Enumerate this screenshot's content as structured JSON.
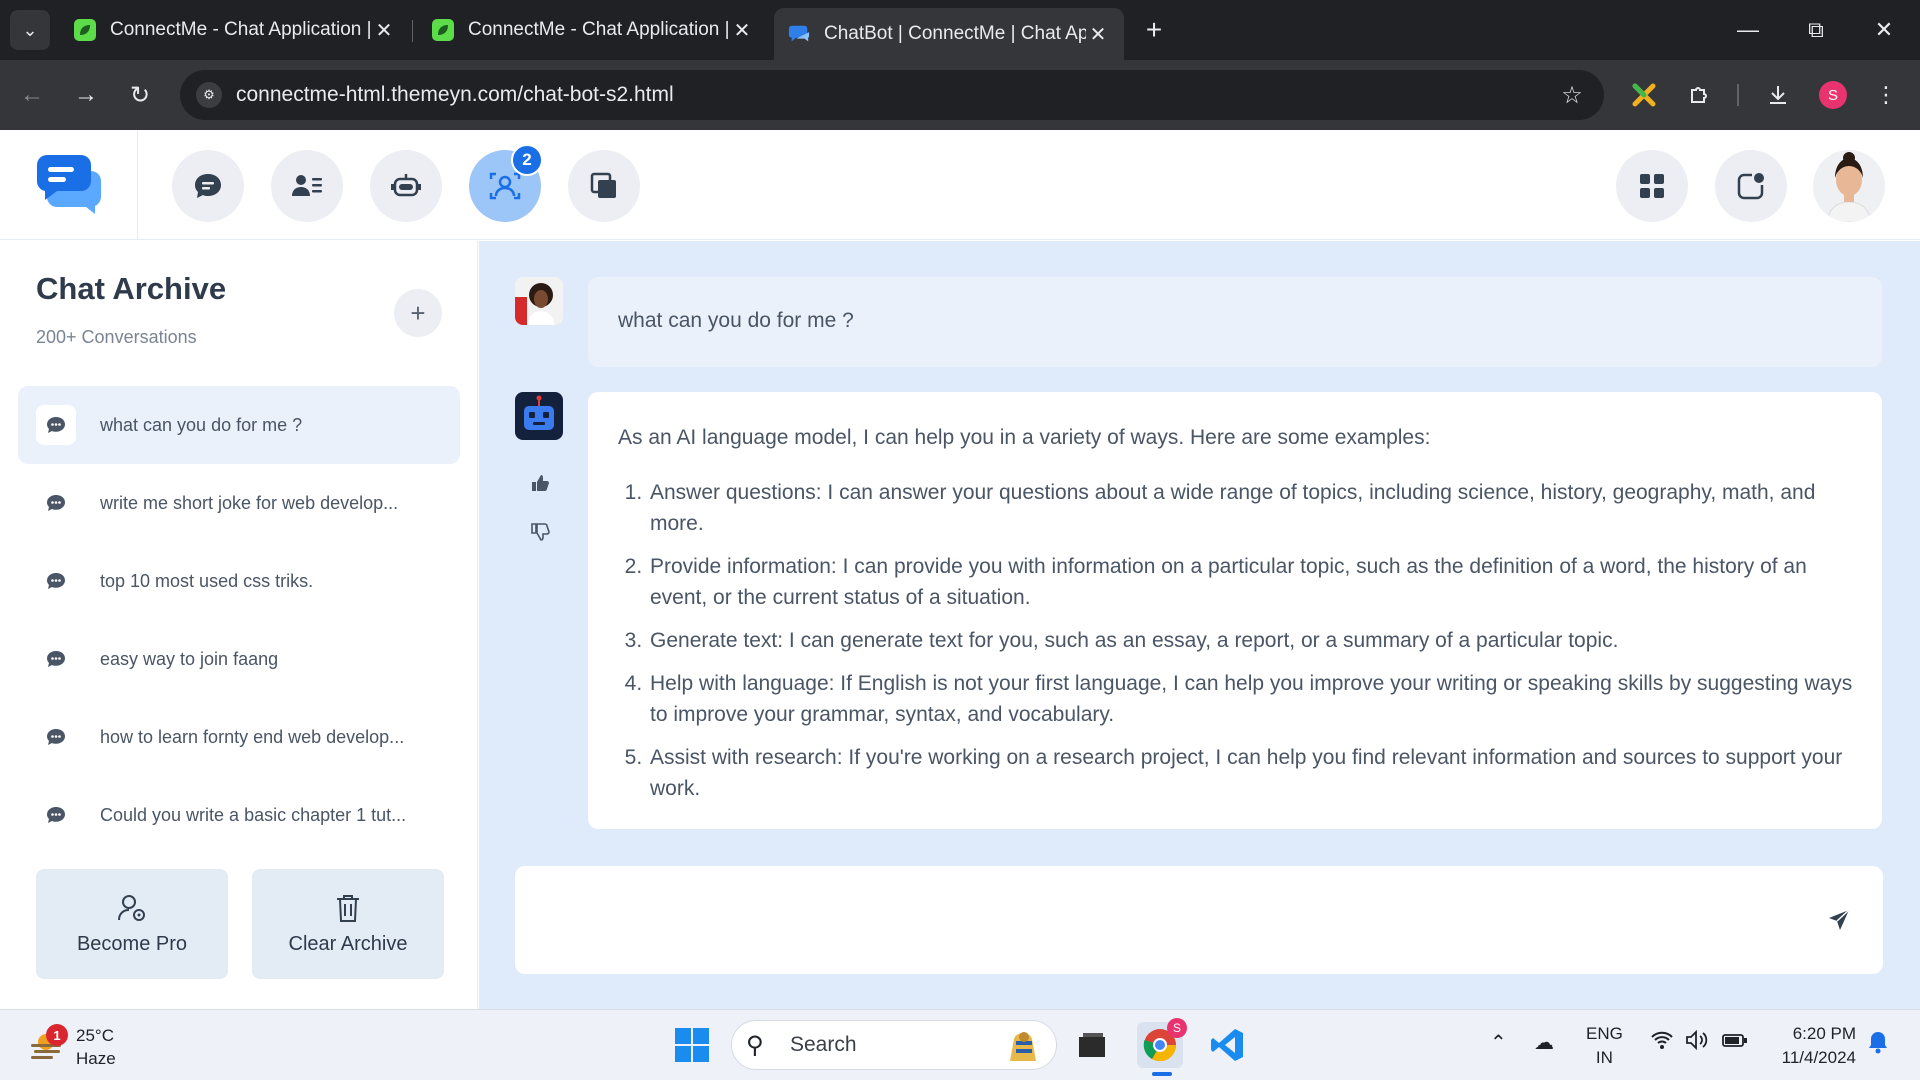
{
  "browser": {
    "tabs": [
      {
        "title": "ConnectMe - Chat Application |",
        "favicon": "leaf-icon",
        "active": false
      },
      {
        "title": "ConnectMe - Chat Application |",
        "favicon": "leaf-icon",
        "active": false
      },
      {
        "title": "ChatBot | ConnectMe | Chat App",
        "favicon": "chat-icon",
        "active": true
      }
    ],
    "url": "connectme-html.themeyn.com/chat-bot-s2.html",
    "profile_initial": "S"
  },
  "header": {
    "nav": [
      {
        "name": "chat-icon",
        "active": false
      },
      {
        "name": "contacts-icon",
        "active": false
      },
      {
        "name": "bot-icon",
        "active": false
      },
      {
        "name": "users-icon",
        "active": true,
        "badge": "2"
      },
      {
        "name": "windows-icon",
        "active": false
      }
    ],
    "accent": "#1a6fe6"
  },
  "sidebar": {
    "title": "Chat Archive",
    "subtitle": "200+ Conversations",
    "items": [
      {
        "label": "what can you do for me ?",
        "active": true
      },
      {
        "label": "write me short joke for web develop...",
        "active": false
      },
      {
        "label": "top 10 most used css triks.",
        "active": false
      },
      {
        "label": "easy way to join faang",
        "active": false
      },
      {
        "label": "how to learn fornty end web develop...",
        "active": false
      },
      {
        "label": "Could you write a basic chapter 1 tut...",
        "active": false
      }
    ],
    "become_pro": "Become Pro",
    "clear_archive": "Clear Archive"
  },
  "chat": {
    "user_message": "what can you do for me ?",
    "bot_intro": "As an AI language model, I can help you in a variety of ways. Here are some examples:",
    "bot_list": [
      "Answer questions: I can answer your questions about a wide range of topics, including science, history, geography, math, and more.",
      "Provide information: I can provide you with information on a particular topic, such as the definition of a word, the history of an event, or the current status of a situation.",
      "Generate text: I can generate text for you, such as an essay, a report, or a summary of a particular topic.",
      "Help with language: If English is not your first language, I can help you improve your writing or speaking skills by suggesting ways to improve your grammar, syntax, and vocabulary.",
      "Assist with research: If you're working on a research project, I can help you find relevant information and sources to support your work."
    ],
    "composer_placeholder": ""
  },
  "taskbar": {
    "weather_temp": "25°C",
    "weather_cond": "Haze",
    "weather_badge": "1",
    "search_label": "Search",
    "lang_top": "ENG",
    "lang_bottom": "IN",
    "time": "6:20 PM",
    "date": "11/4/2024",
    "chrome_badge": "S"
  }
}
